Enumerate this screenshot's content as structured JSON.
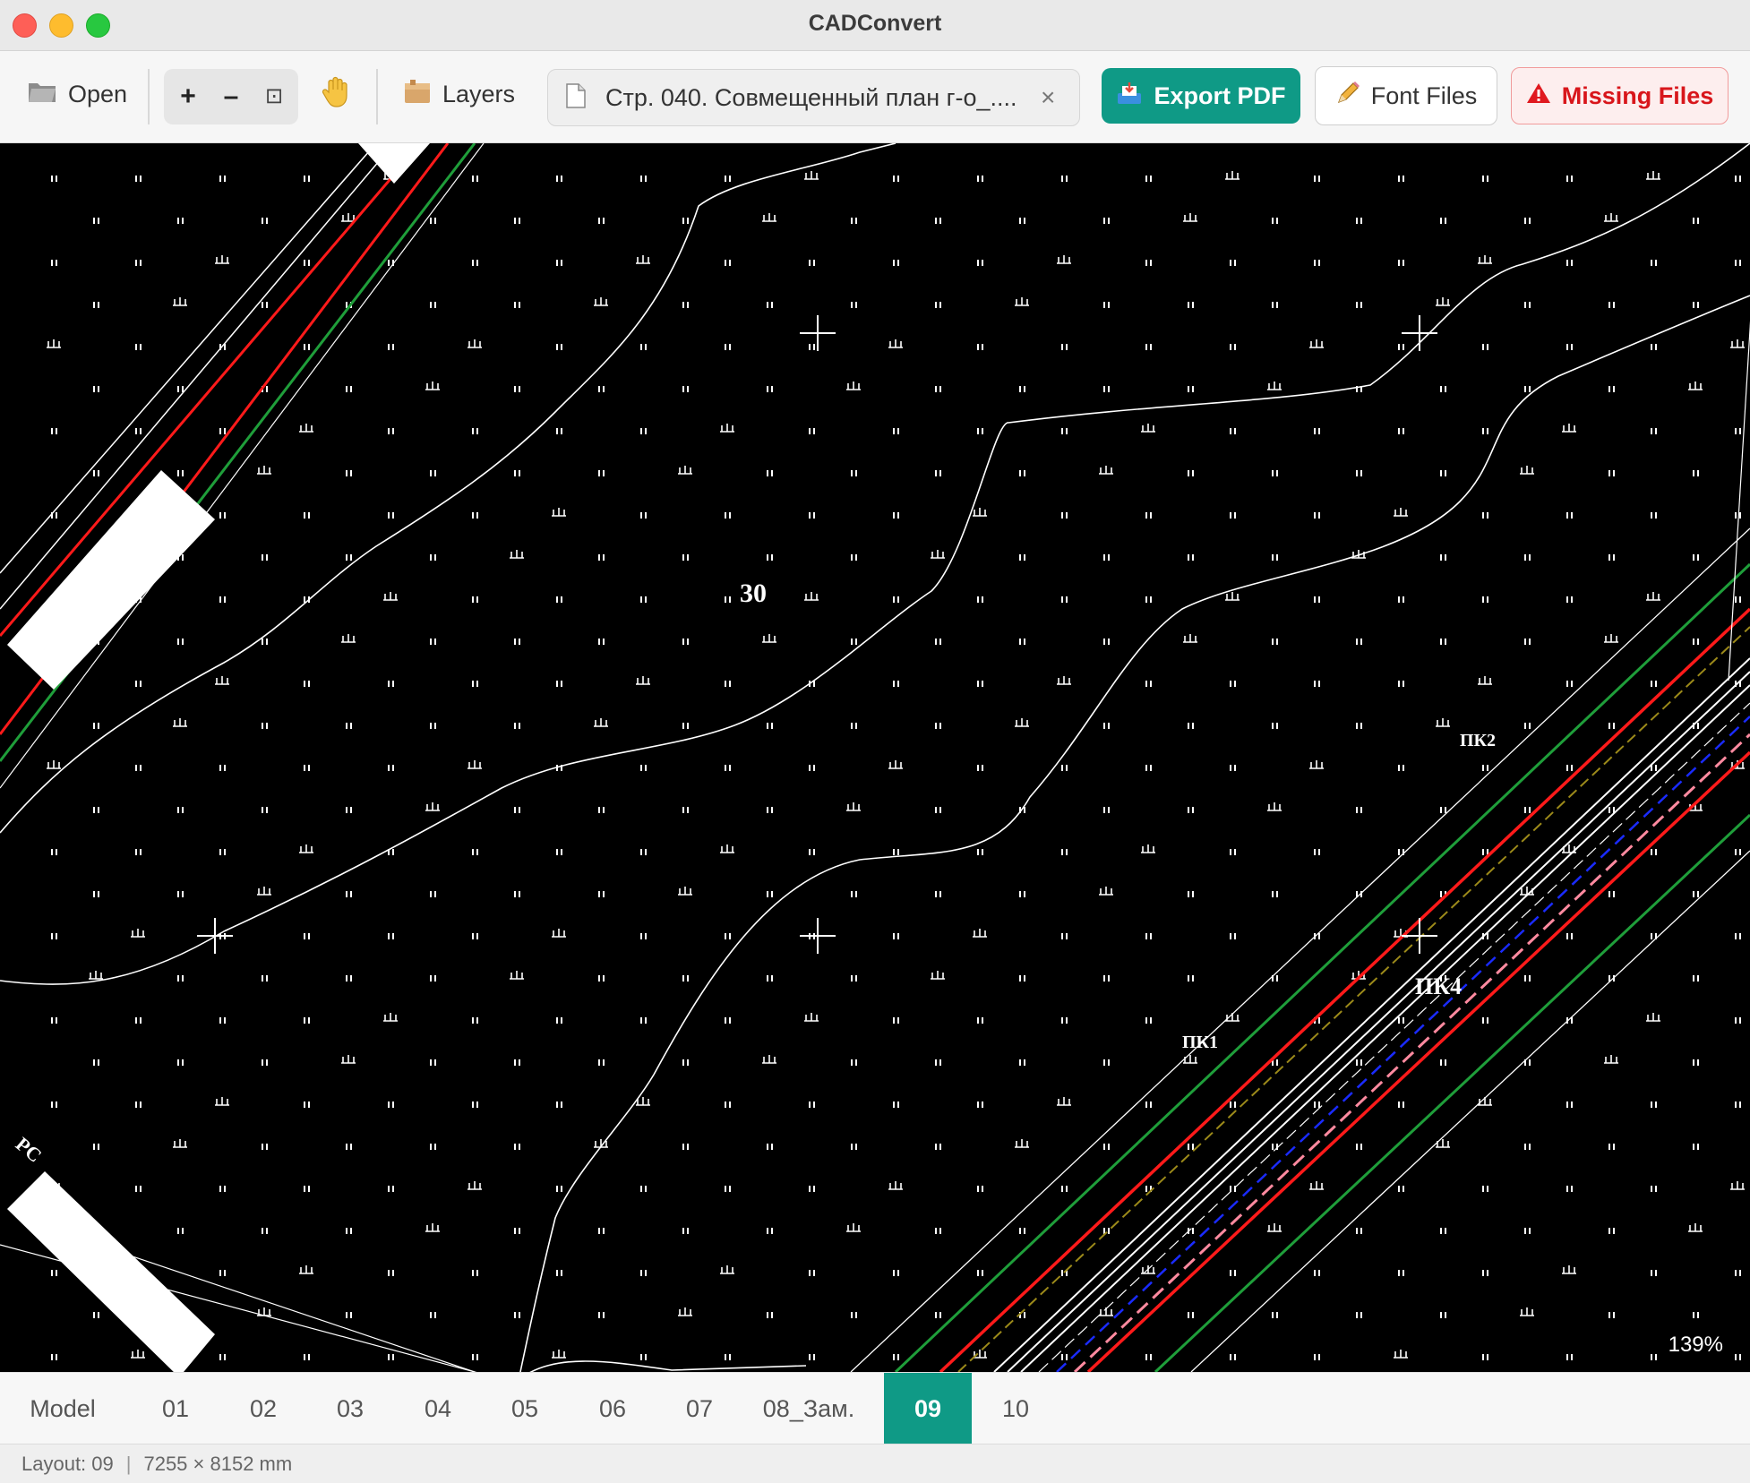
{
  "window": {
    "title": "CADConvert"
  },
  "toolbar": {
    "open_label": "Open",
    "layers_label": "Layers",
    "zoom_in": "+",
    "zoom_out": "–",
    "zoom_fit": "⊡",
    "file_tab": {
      "name": "Стр. 040. Совмещенный план г-о_....",
      "close": "×"
    },
    "export_label": "Export PDF",
    "font_files_label": "Font Files",
    "missing_files_label": "Missing Files"
  },
  "canvas": {
    "zoom": "139%",
    "contour_label": "30",
    "labels": [
      "ПК4",
      "ПК2",
      "ПК1",
      "РС"
    ]
  },
  "tabs": {
    "items": [
      "Model",
      "01",
      "02",
      "03",
      "04",
      "05",
      "06",
      "07",
      "08_Зам.",
      "09",
      "10"
    ],
    "active": "09"
  },
  "status": {
    "layout": "Layout: 09",
    "size": "7255 × 8152 mm"
  },
  "colors": {
    "accent": "#0f9a86",
    "danger": "#d8161b",
    "canvas_bg": "#000000",
    "line_red": "#ff1a1a",
    "line_green": "#1f9e3a",
    "line_blue": "#1a2bff"
  }
}
